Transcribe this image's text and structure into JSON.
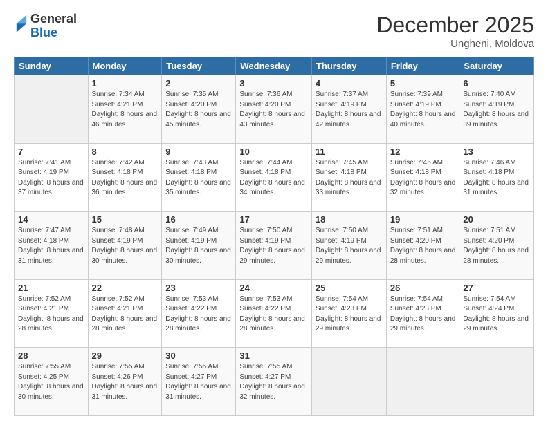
{
  "logo": {
    "general": "General",
    "blue": "Blue"
  },
  "header": {
    "month_year": "December 2025",
    "location": "Ungheni, Moldova"
  },
  "days_of_week": [
    "Sunday",
    "Monday",
    "Tuesday",
    "Wednesday",
    "Thursday",
    "Friday",
    "Saturday"
  ],
  "weeks": [
    [
      {
        "day": "",
        "sunrise": "",
        "sunset": "",
        "daylight": ""
      },
      {
        "day": "1",
        "sunrise": "Sunrise: 7:34 AM",
        "sunset": "Sunset: 4:21 PM",
        "daylight": "Daylight: 8 hours and 46 minutes."
      },
      {
        "day": "2",
        "sunrise": "Sunrise: 7:35 AM",
        "sunset": "Sunset: 4:20 PM",
        "daylight": "Daylight: 8 hours and 45 minutes."
      },
      {
        "day": "3",
        "sunrise": "Sunrise: 7:36 AM",
        "sunset": "Sunset: 4:20 PM",
        "daylight": "Daylight: 8 hours and 43 minutes."
      },
      {
        "day": "4",
        "sunrise": "Sunrise: 7:37 AM",
        "sunset": "Sunset: 4:19 PM",
        "daylight": "Daylight: 8 hours and 42 minutes."
      },
      {
        "day": "5",
        "sunrise": "Sunrise: 7:39 AM",
        "sunset": "Sunset: 4:19 PM",
        "daylight": "Daylight: 8 hours and 40 minutes."
      },
      {
        "day": "6",
        "sunrise": "Sunrise: 7:40 AM",
        "sunset": "Sunset: 4:19 PM",
        "daylight": "Daylight: 8 hours and 39 minutes."
      }
    ],
    [
      {
        "day": "7",
        "sunrise": "Sunrise: 7:41 AM",
        "sunset": "Sunset: 4:19 PM",
        "daylight": "Daylight: 8 hours and 37 minutes."
      },
      {
        "day": "8",
        "sunrise": "Sunrise: 7:42 AM",
        "sunset": "Sunset: 4:18 PM",
        "daylight": "Daylight: 8 hours and 36 minutes."
      },
      {
        "day": "9",
        "sunrise": "Sunrise: 7:43 AM",
        "sunset": "Sunset: 4:18 PM",
        "daylight": "Daylight: 8 hours and 35 minutes."
      },
      {
        "day": "10",
        "sunrise": "Sunrise: 7:44 AM",
        "sunset": "Sunset: 4:18 PM",
        "daylight": "Daylight: 8 hours and 34 minutes."
      },
      {
        "day": "11",
        "sunrise": "Sunrise: 7:45 AM",
        "sunset": "Sunset: 4:18 PM",
        "daylight": "Daylight: 8 hours and 33 minutes."
      },
      {
        "day": "12",
        "sunrise": "Sunrise: 7:46 AM",
        "sunset": "Sunset: 4:18 PM",
        "daylight": "Daylight: 8 hours and 32 minutes."
      },
      {
        "day": "13",
        "sunrise": "Sunrise: 7:46 AM",
        "sunset": "Sunset: 4:18 PM",
        "daylight": "Daylight: 8 hours and 31 minutes."
      }
    ],
    [
      {
        "day": "14",
        "sunrise": "Sunrise: 7:47 AM",
        "sunset": "Sunset: 4:18 PM",
        "daylight": "Daylight: 8 hours and 31 minutes."
      },
      {
        "day": "15",
        "sunrise": "Sunrise: 7:48 AM",
        "sunset": "Sunset: 4:19 PM",
        "daylight": "Daylight: 8 hours and 30 minutes."
      },
      {
        "day": "16",
        "sunrise": "Sunrise: 7:49 AM",
        "sunset": "Sunset: 4:19 PM",
        "daylight": "Daylight: 8 hours and 30 minutes."
      },
      {
        "day": "17",
        "sunrise": "Sunrise: 7:50 AM",
        "sunset": "Sunset: 4:19 PM",
        "daylight": "Daylight: 8 hours and 29 minutes."
      },
      {
        "day": "18",
        "sunrise": "Sunrise: 7:50 AM",
        "sunset": "Sunset: 4:19 PM",
        "daylight": "Daylight: 8 hours and 29 minutes."
      },
      {
        "day": "19",
        "sunrise": "Sunrise: 7:51 AM",
        "sunset": "Sunset: 4:20 PM",
        "daylight": "Daylight: 8 hours and 28 minutes."
      },
      {
        "day": "20",
        "sunrise": "Sunrise: 7:51 AM",
        "sunset": "Sunset: 4:20 PM",
        "daylight": "Daylight: 8 hours and 28 minutes."
      }
    ],
    [
      {
        "day": "21",
        "sunrise": "Sunrise: 7:52 AM",
        "sunset": "Sunset: 4:21 PM",
        "daylight": "Daylight: 8 hours and 28 minutes."
      },
      {
        "day": "22",
        "sunrise": "Sunrise: 7:52 AM",
        "sunset": "Sunset: 4:21 PM",
        "daylight": "Daylight: 8 hours and 28 minutes."
      },
      {
        "day": "23",
        "sunrise": "Sunrise: 7:53 AM",
        "sunset": "Sunset: 4:22 PM",
        "daylight": "Daylight: 8 hours and 28 minutes."
      },
      {
        "day": "24",
        "sunrise": "Sunrise: 7:53 AM",
        "sunset": "Sunset: 4:22 PM",
        "daylight": "Daylight: 8 hours and 28 minutes."
      },
      {
        "day": "25",
        "sunrise": "Sunrise: 7:54 AM",
        "sunset": "Sunset: 4:23 PM",
        "daylight": "Daylight: 8 hours and 29 minutes."
      },
      {
        "day": "26",
        "sunrise": "Sunrise: 7:54 AM",
        "sunset": "Sunset: 4:23 PM",
        "daylight": "Daylight: 8 hours and 29 minutes."
      },
      {
        "day": "27",
        "sunrise": "Sunrise: 7:54 AM",
        "sunset": "Sunset: 4:24 PM",
        "daylight": "Daylight: 8 hours and 29 minutes."
      }
    ],
    [
      {
        "day": "28",
        "sunrise": "Sunrise: 7:55 AM",
        "sunset": "Sunset: 4:25 PM",
        "daylight": "Daylight: 8 hours and 30 minutes."
      },
      {
        "day": "29",
        "sunrise": "Sunrise: 7:55 AM",
        "sunset": "Sunset: 4:26 PM",
        "daylight": "Daylight: 8 hours and 31 minutes."
      },
      {
        "day": "30",
        "sunrise": "Sunrise: 7:55 AM",
        "sunset": "Sunset: 4:27 PM",
        "daylight": "Daylight: 8 hours and 31 minutes."
      },
      {
        "day": "31",
        "sunrise": "Sunrise: 7:55 AM",
        "sunset": "Sunset: 4:27 PM",
        "daylight": "Daylight: 8 hours and 32 minutes."
      },
      {
        "day": "",
        "sunrise": "",
        "sunset": "",
        "daylight": ""
      },
      {
        "day": "",
        "sunrise": "",
        "sunset": "",
        "daylight": ""
      },
      {
        "day": "",
        "sunrise": "",
        "sunset": "",
        "daylight": ""
      }
    ]
  ]
}
